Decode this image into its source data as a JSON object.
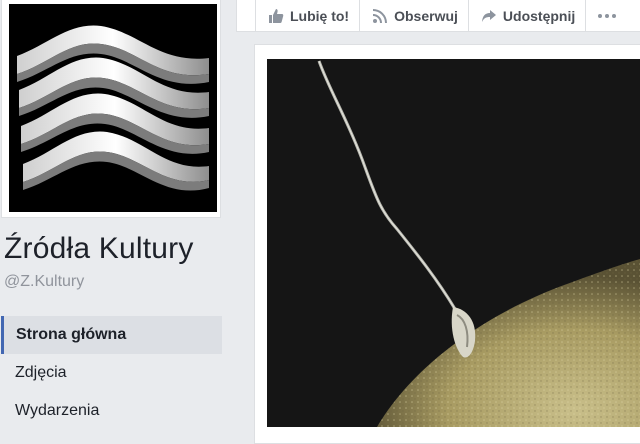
{
  "page": {
    "name": "Źródła Kultury",
    "handle": "@Z.Kultury"
  },
  "nav": {
    "items": [
      {
        "label": "Strona główna",
        "active": true
      },
      {
        "label": "Zdjęcia",
        "active": false
      },
      {
        "label": "Wydarzenia",
        "active": false
      }
    ]
  },
  "actions": {
    "like_label": "Lubię to!",
    "follow_label": "Obserwuj",
    "share_label": "Udostępnij",
    "more_icon": "more-dots-icon"
  },
  "colors": {
    "background": "#e9ebee",
    "active_nav_bar": "#4267b2",
    "text": "#1d2129",
    "muted": "#90949c"
  }
}
